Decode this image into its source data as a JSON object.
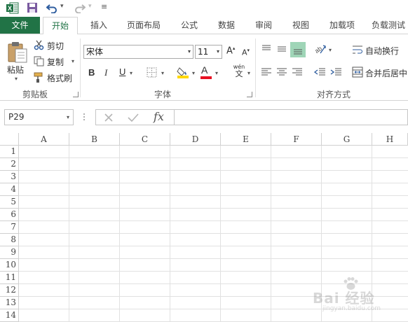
{
  "qat": {
    "undo_dd": "▾",
    "redo_dd": "▾",
    "customize": "≡"
  },
  "tabs": [
    {
      "label": "文件"
    },
    {
      "label": "开始"
    },
    {
      "label": "插入"
    },
    {
      "label": "页面布局"
    },
    {
      "label": "公式"
    },
    {
      "label": "数据"
    },
    {
      "label": "审阅"
    },
    {
      "label": "视图"
    },
    {
      "label": "加载项"
    },
    {
      "label": "负载测试"
    }
  ],
  "clipboard": {
    "group_label": "剪贴板",
    "paste": "粘贴",
    "cut": "剪切",
    "copy": "复制",
    "format_painter": "格式刷"
  },
  "font": {
    "group_label": "字体",
    "font_name": "宋体",
    "font_size": "11",
    "bold": "B",
    "italic": "I",
    "underline": "U",
    "increase": "A",
    "decrease": "A",
    "font_color_letter": "A",
    "phonetic_top": "wén",
    "phonetic_bottom": "文",
    "font_color": "#e81123",
    "fill_color": "#ffd800"
  },
  "alignment": {
    "group_label": "对齐方式",
    "wrap_text": "自动换行",
    "merge_center": "合并后居中"
  },
  "formula_bar": {
    "name_box": "P29",
    "fx": "fx",
    "formula": ""
  },
  "grid": {
    "columns": [
      "A",
      "B",
      "C",
      "D",
      "E",
      "F",
      "G",
      "H"
    ],
    "rows": [
      "1",
      "2",
      "3",
      "4",
      "5",
      "6",
      "7",
      "8",
      "9",
      "10",
      "11",
      "12",
      "13",
      "14"
    ]
  },
  "watermark": {
    "text": "Bai 经验",
    "sub": "jingyan.baidu.com"
  },
  "colors": {
    "accent": "#217346"
  }
}
